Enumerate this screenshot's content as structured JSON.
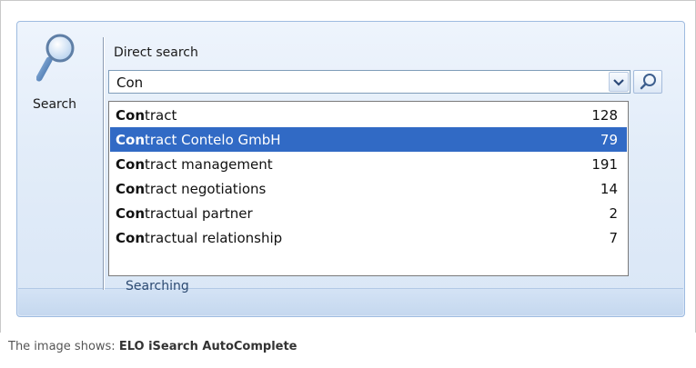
{
  "ribbon": {
    "search_button_label": "Search",
    "field_label": "Direct search",
    "group_label": "Searching"
  },
  "combo": {
    "value": "Con"
  },
  "suggestions": [
    {
      "prefix": "Con",
      "rest": "tract",
      "count": "128",
      "selected": false
    },
    {
      "prefix": "Con",
      "rest": "tract Contelo GmbH",
      "count": "79",
      "selected": true
    },
    {
      "prefix": "Con",
      "rest": "tract management",
      "count": "191",
      "selected": false
    },
    {
      "prefix": "Con",
      "rest": "tract negotiations",
      "count": "14",
      "selected": false
    },
    {
      "prefix": "Con",
      "rest": "tractual partner",
      "count": "2",
      "selected": false
    },
    {
      "prefix": "Con",
      "rest": "tractual relationship",
      "count": "7",
      "selected": false
    }
  ],
  "caption": {
    "prefix": "The image shows: ",
    "title": "ELO iSearch AutoComplete"
  },
  "colors": {
    "selection": "#316ac5",
    "ribbon_border": "#9ebbe0"
  }
}
